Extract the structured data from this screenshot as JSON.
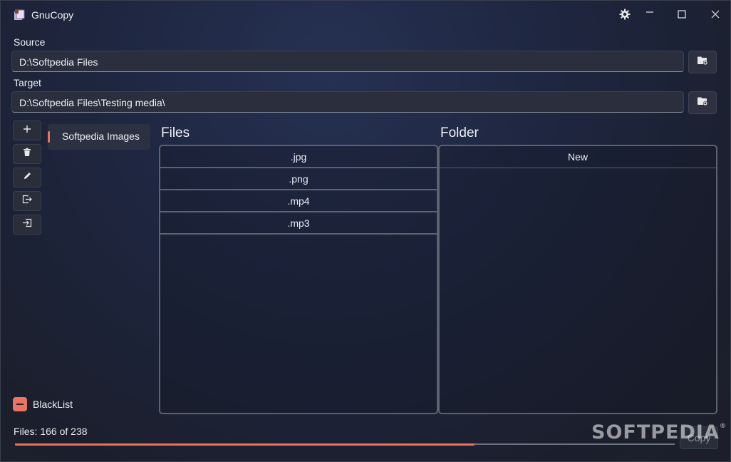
{
  "window": {
    "title": "GnuCopy"
  },
  "source": {
    "label": "Source",
    "value": "D:\\Softpedia Files"
  },
  "target": {
    "label": "Target",
    "value": "D:\\Softpedia Files\\Testing media\\"
  },
  "profiles": [
    {
      "label": "Softpedia Images",
      "selected": true
    }
  ],
  "files": {
    "title": "Files",
    "rows": [
      ".jpg",
      ".png",
      ".mp4",
      ".mp3"
    ]
  },
  "folder": {
    "title": "Folder",
    "rows": [
      "New"
    ]
  },
  "blacklist": {
    "label": "BlackList",
    "checked": true
  },
  "status": {
    "text": "Files: 166 of 238",
    "progress": 0.697
  },
  "copy_button": {
    "label": "Copy"
  },
  "watermark": {
    "text": "SOFTPEDIA",
    "mark": "®"
  },
  "colors": {
    "accent": "#e9735f",
    "background": "#1e2640",
    "border": "#5c6270"
  },
  "icons": {
    "titlebar": [
      "settings-gear-icon",
      "minimize-icon",
      "maximize-icon",
      "close-icon"
    ],
    "sidebar": [
      "add-icon",
      "delete-icon",
      "edit-icon",
      "export-icon",
      "import-icon"
    ],
    "browse": "folder-browse-icon"
  }
}
